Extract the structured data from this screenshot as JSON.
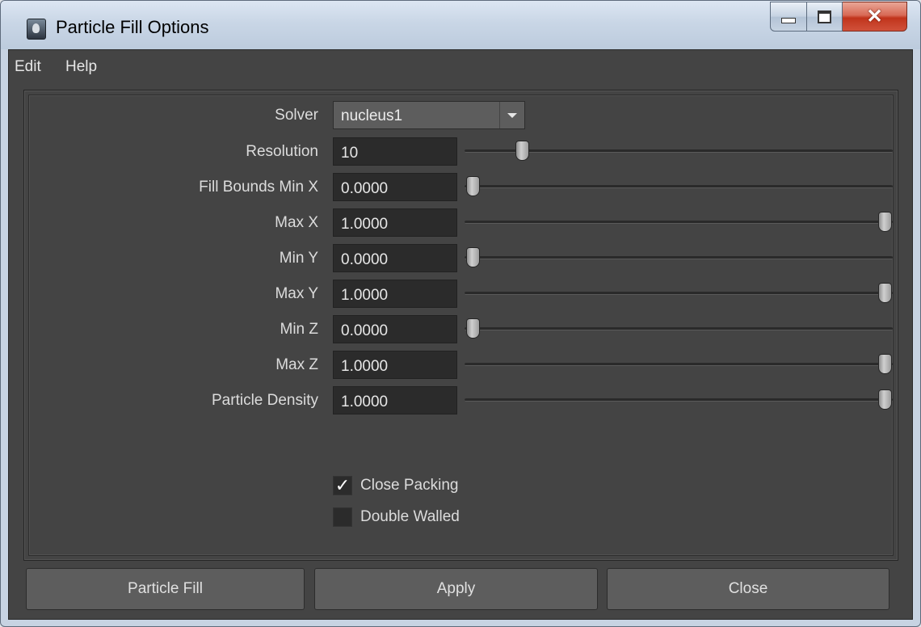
{
  "window": {
    "title": "Particle Fill Options",
    "controls": {
      "minimize": "minimize-icon",
      "maximize": "maximize-icon",
      "close": "close-icon"
    }
  },
  "menu": [
    "Edit",
    "Help"
  ],
  "solver": {
    "label": "Solver",
    "value": "nucleus1"
  },
  "fields": [
    {
      "label": "Resolution",
      "value": "10",
      "slider": 0.12
    },
    {
      "label": "Fill Bounds Min X",
      "value": "0.0000",
      "slider": 0.0
    },
    {
      "label": "Max X",
      "value": "1.0000",
      "slider": 1.0
    },
    {
      "label": "Min Y",
      "value": "0.0000",
      "slider": 0.0
    },
    {
      "label": "Max Y",
      "value": "1.0000",
      "slider": 1.0
    },
    {
      "label": "Min Z",
      "value": "0.0000",
      "slider": 0.0
    },
    {
      "label": "Max Z",
      "value": "1.0000",
      "slider": 1.0
    },
    {
      "label": "Particle Density",
      "value": "1.0000",
      "slider": 1.0
    }
  ],
  "checkboxes": [
    {
      "label": "Close Packing",
      "checked": true
    },
    {
      "label": "Double Walled",
      "checked": false
    }
  ],
  "buttons": [
    "Particle Fill",
    "Apply",
    "Close"
  ]
}
